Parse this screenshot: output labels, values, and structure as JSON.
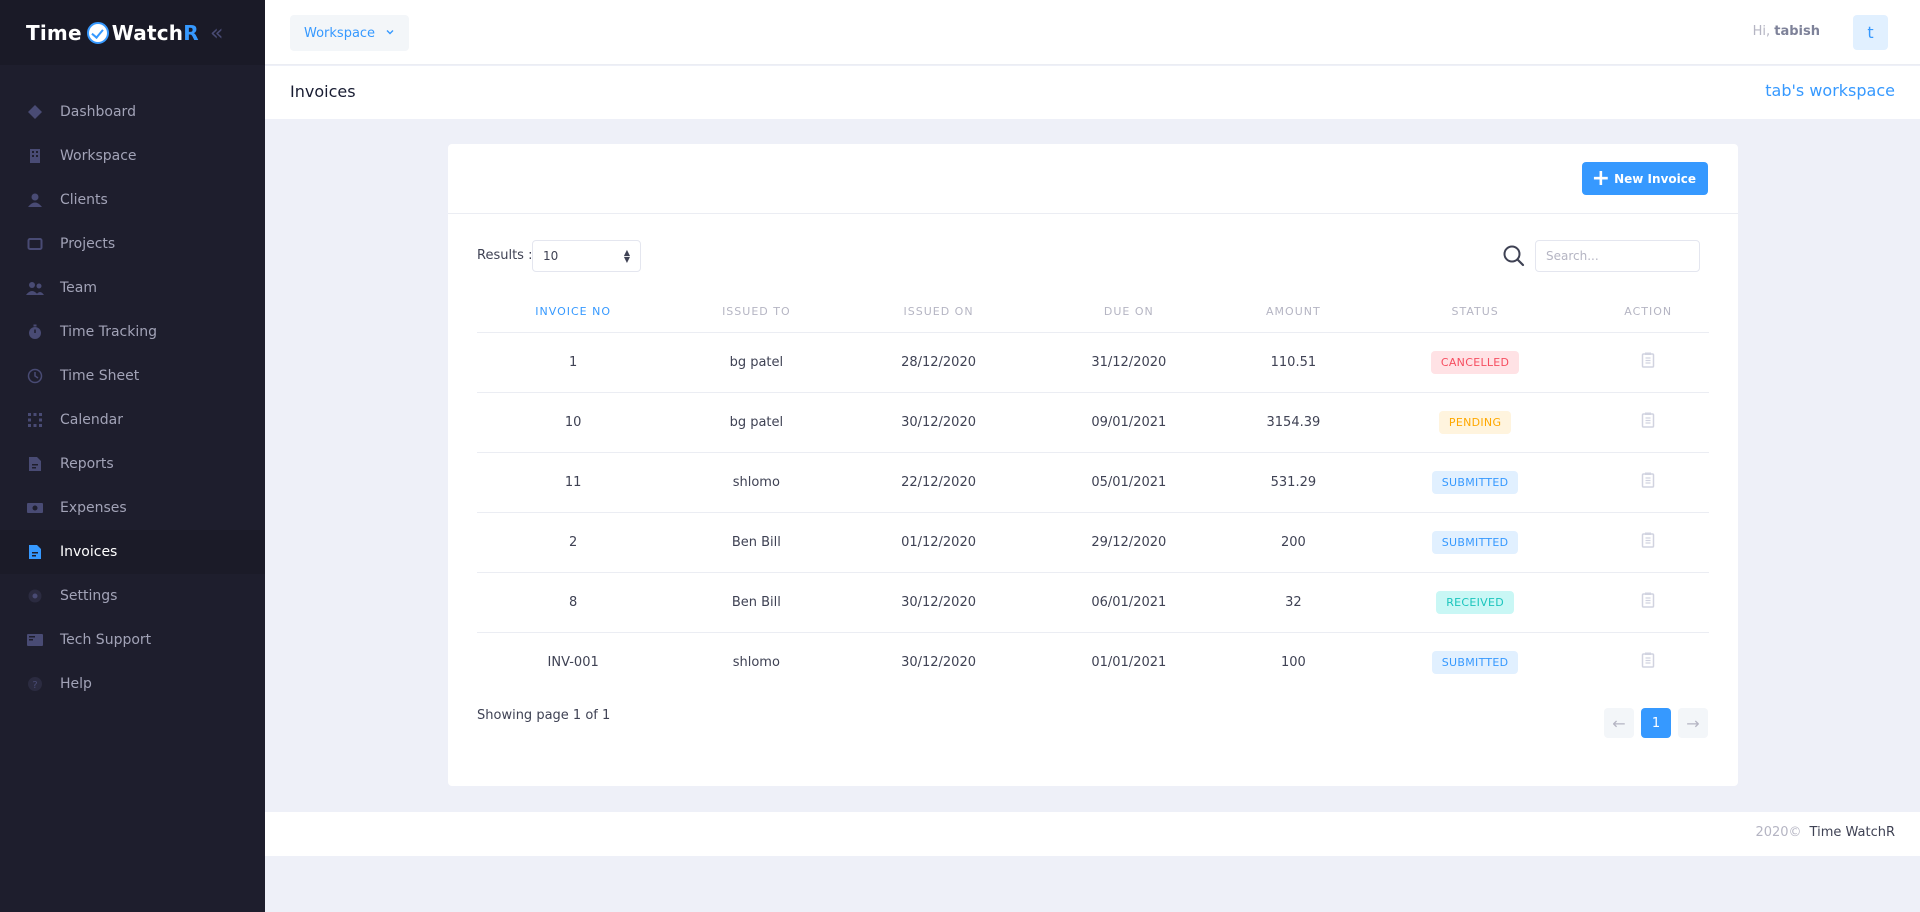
{
  "brand": {
    "part1": "Time",
    "part2": "Watch",
    "part3": "R"
  },
  "sidebar": {
    "collapse_glyph": "«",
    "items": [
      {
        "label": "Dashboard",
        "icon": "dashboard-icon"
      },
      {
        "label": "Workspace",
        "icon": "building-icon"
      },
      {
        "label": "Clients",
        "icon": "user-icon"
      },
      {
        "label": "Projects",
        "icon": "folder-icon"
      },
      {
        "label": "Team",
        "icon": "team-icon"
      },
      {
        "label": "Time Tracking",
        "icon": "stopwatch-icon"
      },
      {
        "label": "Time Sheet",
        "icon": "clock-icon"
      },
      {
        "label": "Calendar",
        "icon": "calendar-icon"
      },
      {
        "label": "Reports",
        "icon": "report-icon"
      },
      {
        "label": "Expenses",
        "icon": "money-icon"
      },
      {
        "label": "Invoices",
        "icon": "invoice-icon",
        "active": true
      },
      {
        "label": "Settings",
        "icon": "settings-icon"
      },
      {
        "label": "Tech Support",
        "icon": "support-icon"
      },
      {
        "label": "Help",
        "icon": "help-icon"
      }
    ]
  },
  "header": {
    "workspace_button": "Workspace",
    "greeting": "Hi,",
    "username": "tabish",
    "avatar_letter": "t"
  },
  "subheader": {
    "title": "Invoices",
    "workspace_name": "tab's workspace"
  },
  "card": {
    "new_invoice_button": "New Invoice",
    "results_label": "Results :",
    "results_value": "10",
    "search_placeholder": "Search..."
  },
  "table": {
    "columns": [
      "INVOICE NO",
      "ISSUED TO",
      "ISSUED ON",
      "DUE ON",
      "AMOUNT",
      "STATUS",
      "ACTION"
    ],
    "rows": [
      {
        "invoice_no": "1",
        "issued_to": "bg patel",
        "issued_on": "28/12/2020",
        "due_on": "31/12/2020",
        "amount": "110.51",
        "status": "CANCELLED"
      },
      {
        "invoice_no": "10",
        "issued_to": "bg patel",
        "issued_on": "30/12/2020",
        "due_on": "09/01/2021",
        "amount": "3154.39",
        "status": "PENDING"
      },
      {
        "invoice_no": "11",
        "issued_to": "shlomo",
        "issued_on": "22/12/2020",
        "due_on": "05/01/2021",
        "amount": "531.29",
        "status": "SUBMITTED"
      },
      {
        "invoice_no": "2",
        "issued_to": "Ben Bill",
        "issued_on": "01/12/2020",
        "due_on": "29/12/2020",
        "amount": "200",
        "status": "SUBMITTED"
      },
      {
        "invoice_no": "8",
        "issued_to": "Ben Bill",
        "issued_on": "30/12/2020",
        "due_on": "06/01/2021",
        "amount": "32",
        "status": "RECEIVED"
      },
      {
        "invoice_no": "INV-001",
        "issued_to": "shlomo",
        "issued_on": "30/12/2020",
        "due_on": "01/01/2021",
        "amount": "100",
        "status": "SUBMITTED"
      }
    ]
  },
  "status_colors": {
    "CANCELLED": {
      "bg": "#ffe2e5",
      "fg": "#f64e60"
    },
    "PENDING": {
      "bg": "#fff4de",
      "fg": "#ffa800"
    },
    "SUBMITTED": {
      "bg": "#e1f0ff",
      "fg": "#3699ff"
    },
    "RECEIVED": {
      "bg": "#c9f7f5",
      "fg": "#1bc5bd"
    }
  },
  "pagination": {
    "showing": "Showing page 1 of 1",
    "current_page": "1",
    "prev_glyph": "←",
    "next_glyph": "→"
  },
  "footer": {
    "year": "2020©",
    "brand": "Time WatchR"
  },
  "colors": {
    "accent": "#3699ff",
    "sidebar_bg": "#1e1e2d",
    "brand_bg": "#1a1a27",
    "page_bg": "#eef0f8"
  }
}
